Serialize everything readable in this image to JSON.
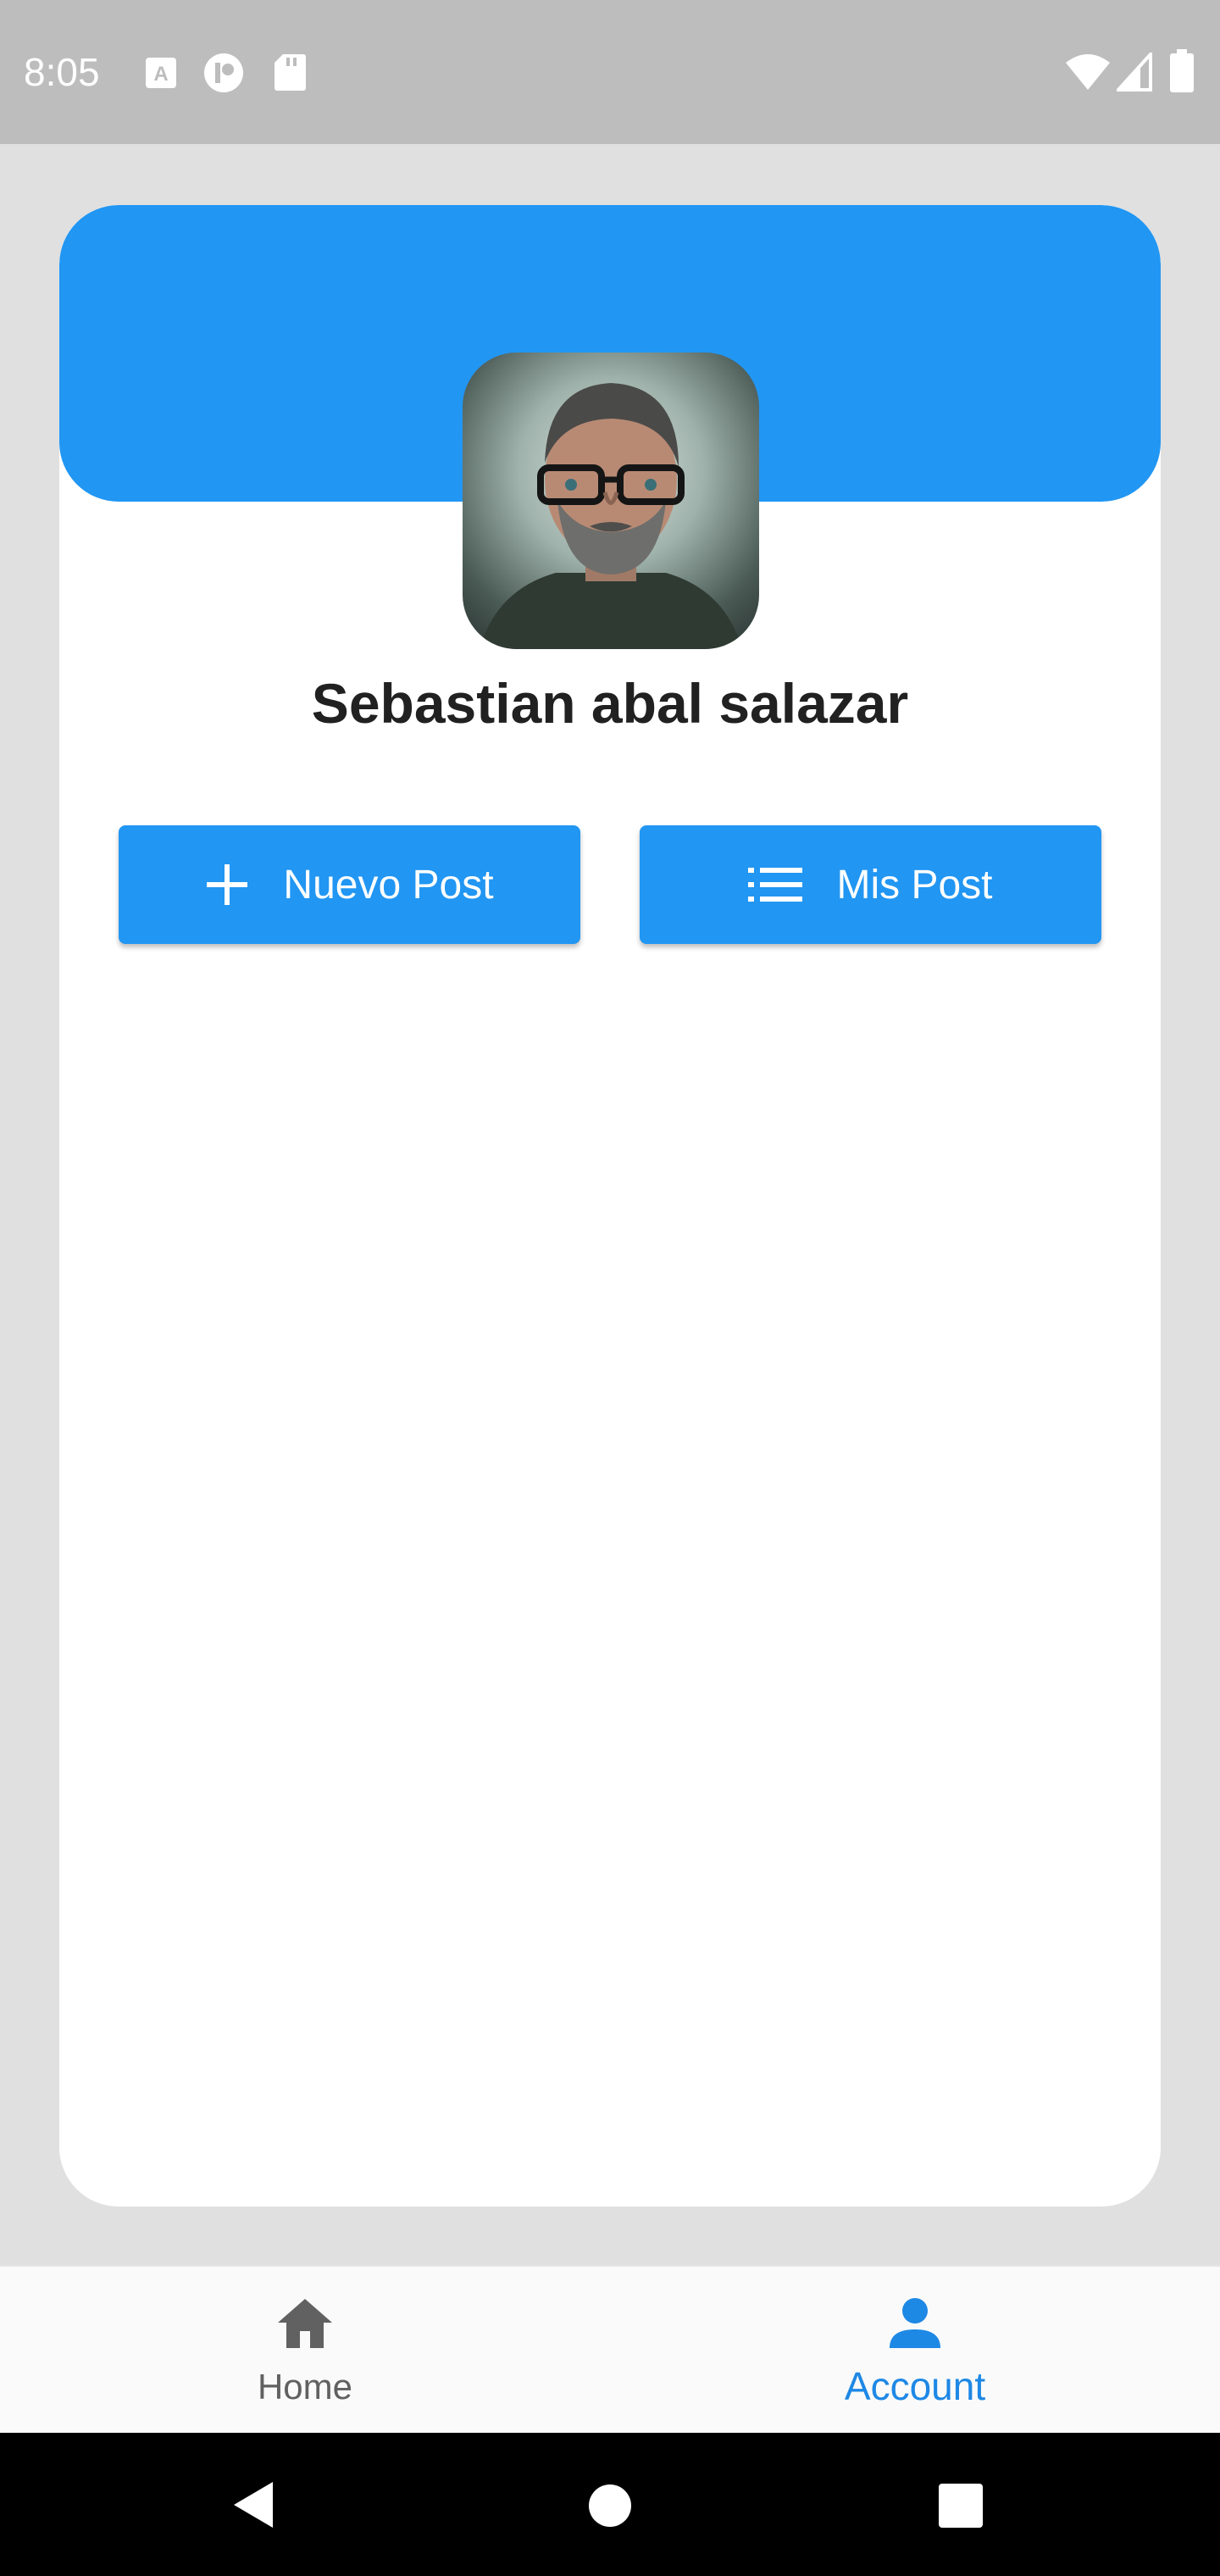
{
  "status_bar": {
    "time": "8:05",
    "left_icons": [
      "a-icon",
      "p-icon",
      "sd-card-icon"
    ],
    "right_icons": [
      "wifi-icon",
      "signal-icon",
      "battery-icon"
    ]
  },
  "profile": {
    "name": "Sebastian abal salazar",
    "avatar": "profile-photo"
  },
  "actions": {
    "new_post": {
      "label": "Nuevo Post",
      "icon": "plus-icon"
    },
    "my_posts": {
      "label": "Mis Post",
      "icon": "list-icon"
    }
  },
  "bottom_nav": {
    "items": [
      {
        "label": "Home",
        "icon": "home-icon",
        "active": false
      },
      {
        "label": "Account",
        "icon": "person-icon",
        "active": true
      }
    ]
  },
  "system_nav": [
    "back-icon",
    "home-circle-icon",
    "recents-icon"
  ],
  "colors": {
    "primary": "#2196f3",
    "active_nav": "#1e88e5",
    "background": "#e0e0e0",
    "status_bar": "#bdbdbd"
  }
}
